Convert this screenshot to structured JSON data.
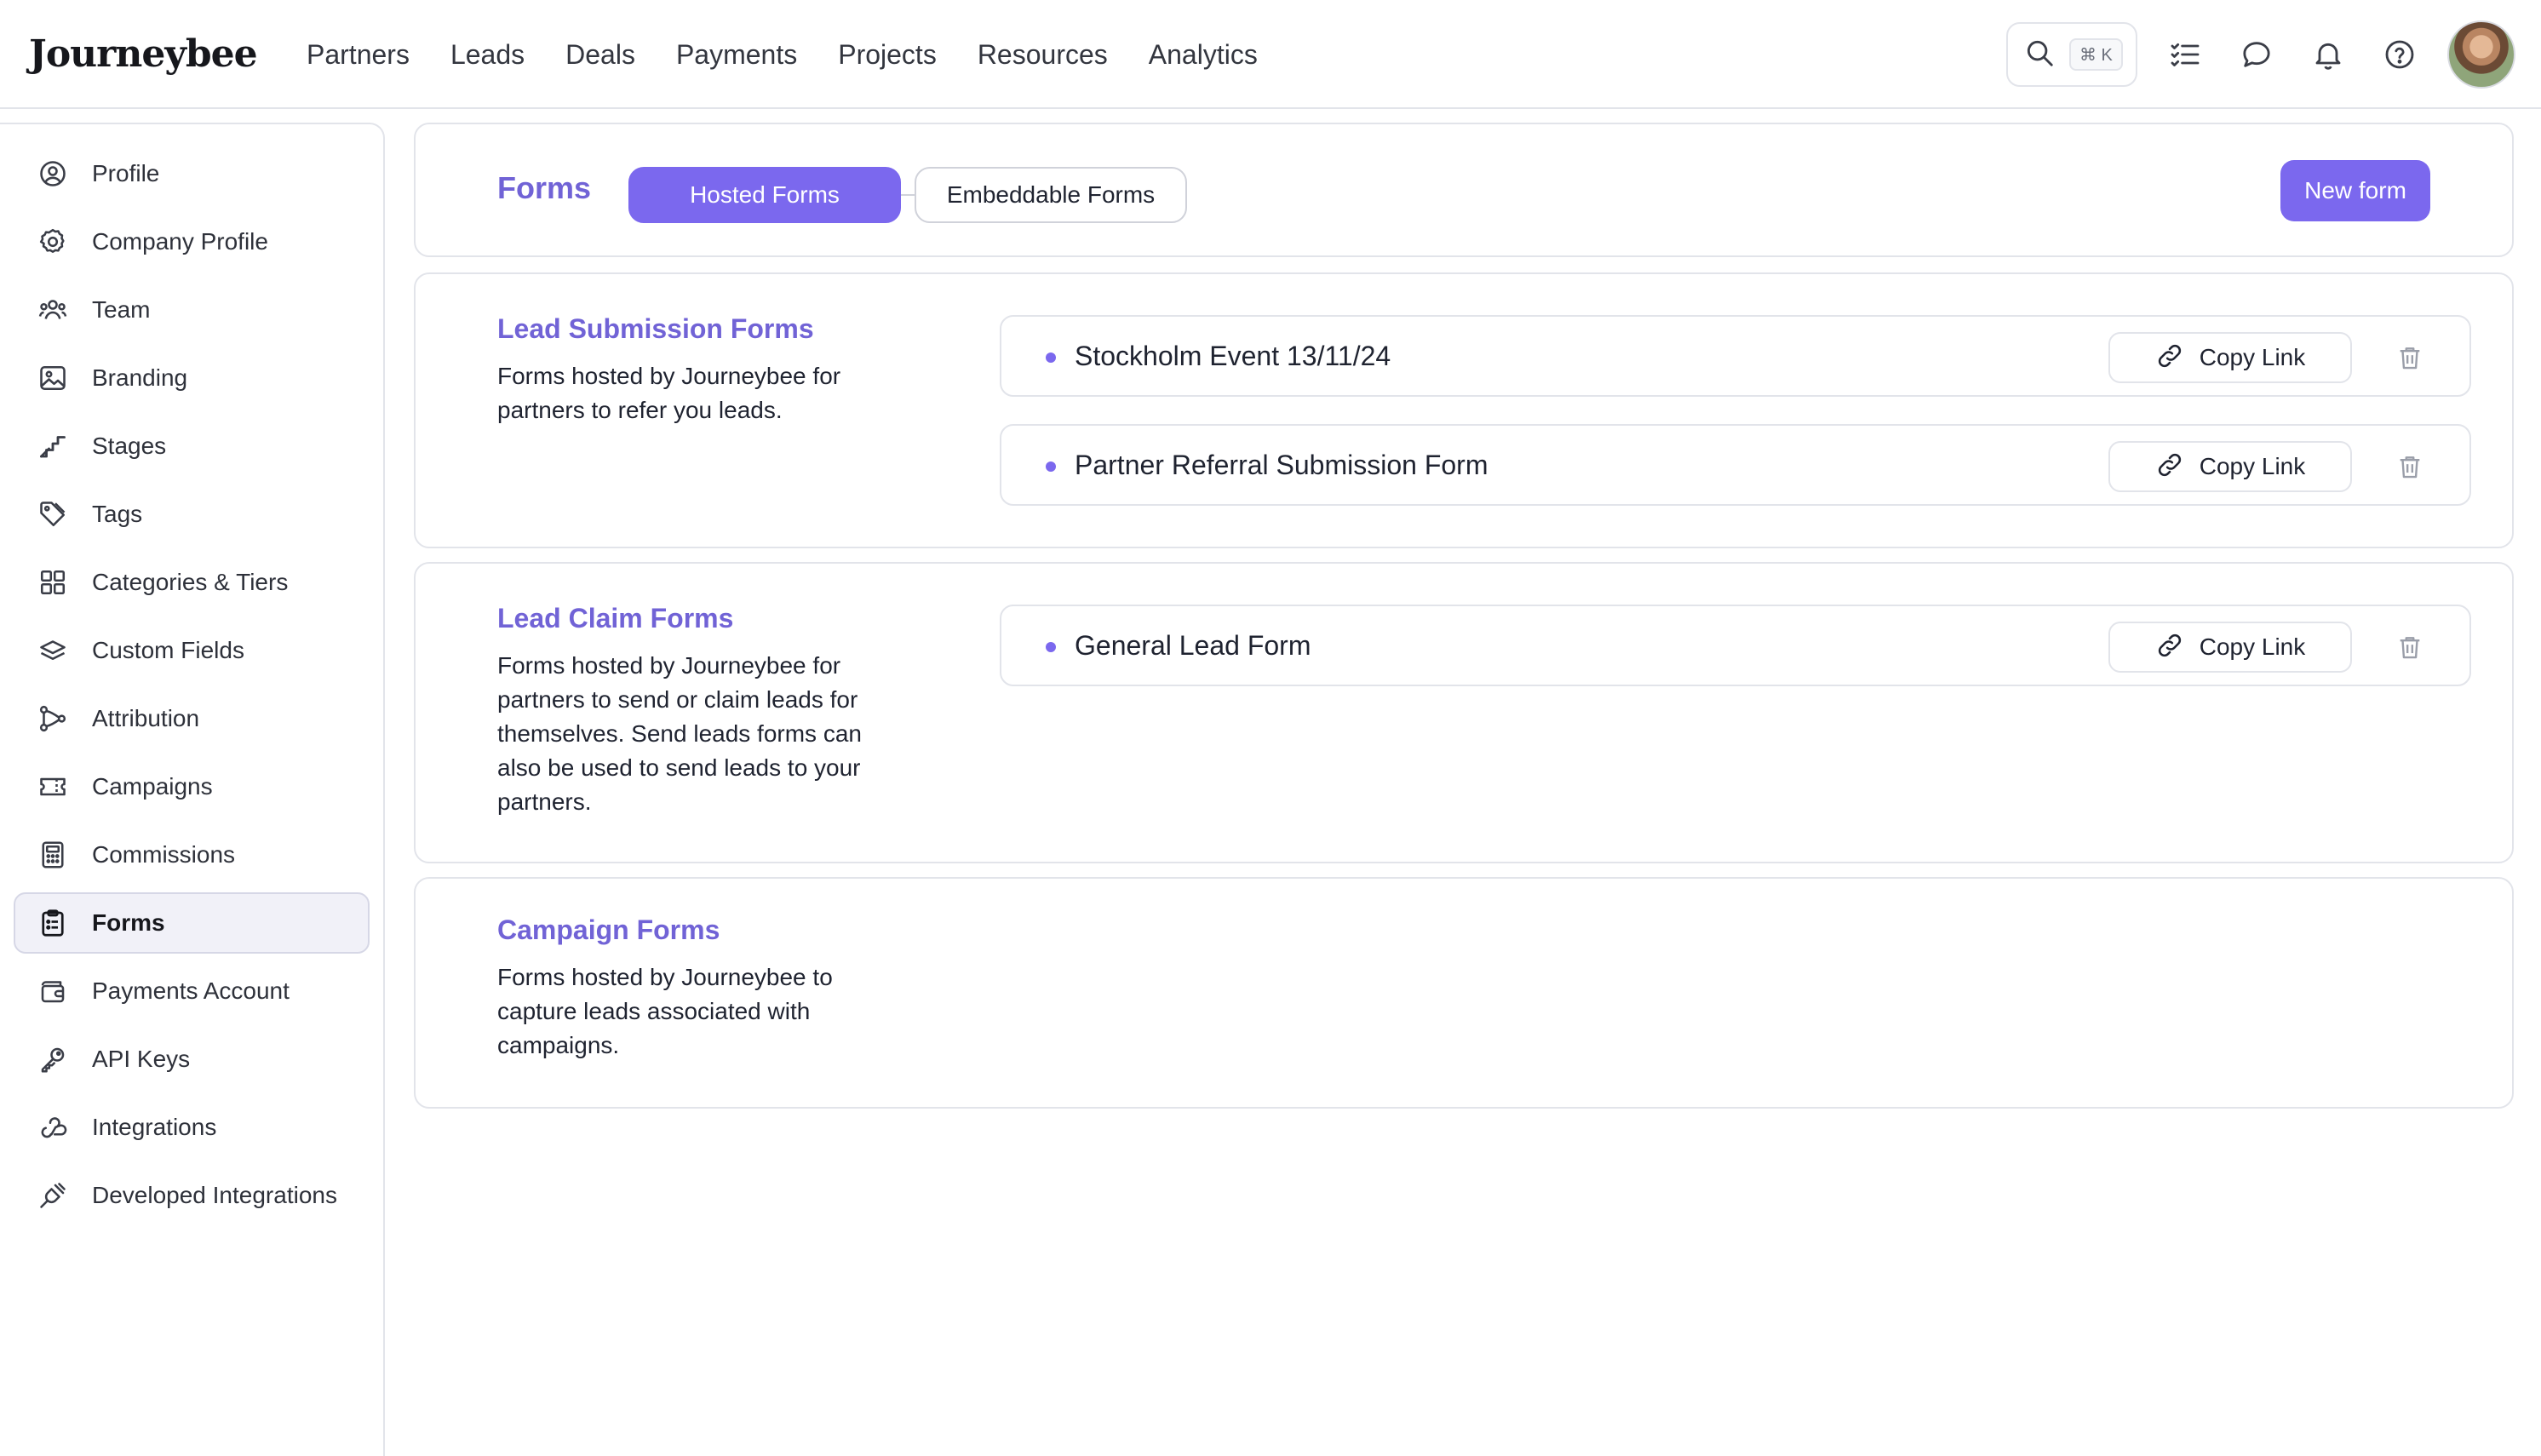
{
  "app": {
    "logo_text": "Journeybee"
  },
  "nav": {
    "items": [
      "Partners",
      "Leads",
      "Deals",
      "Payments",
      "Projects",
      "Resources",
      "Analytics"
    ]
  },
  "search": {
    "shortcut": "⌘ K"
  },
  "top_icons": [
    "search-icon",
    "checklist-icon",
    "chat-icon",
    "bell-icon",
    "help-icon"
  ],
  "sidebar": {
    "items": [
      {
        "label": "Profile",
        "icon": "user-circle-icon"
      },
      {
        "label": "Company Profile",
        "icon": "gear-icon"
      },
      {
        "label": "Team",
        "icon": "team-icon"
      },
      {
        "label": "Branding",
        "icon": "image-icon"
      },
      {
        "label": "Stages",
        "icon": "stairs-icon"
      },
      {
        "label": "Tags",
        "icon": "tag-icon"
      },
      {
        "label": "Categories & Tiers",
        "icon": "grid-icon"
      },
      {
        "label": "Custom Fields",
        "icon": "layers-icon"
      },
      {
        "label": "Attribution",
        "icon": "nodes-icon"
      },
      {
        "label": "Campaigns",
        "icon": "ticket-icon"
      },
      {
        "label": "Commissions",
        "icon": "calculator-icon"
      },
      {
        "label": "Forms",
        "icon": "clipboard-icon",
        "active": true
      },
      {
        "label": "Payments Account",
        "icon": "wallet-icon"
      },
      {
        "label": "API Keys",
        "icon": "key-icon"
      },
      {
        "label": "Integrations",
        "icon": "webhook-icon"
      },
      {
        "label": "Developed Integrations",
        "icon": "plug-icon"
      }
    ]
  },
  "header": {
    "title": "Forms",
    "tab_hosted": "Hosted Forms",
    "tab_embeddable": "Embeddable Forms",
    "active_tab": "Hosted Forms",
    "new_button": "New form"
  },
  "sections": [
    {
      "title": "Lead Submission Forms",
      "description": "Forms hosted by Journeybee for partners to refer you leads.",
      "forms": [
        "Stockholm Event 13/11/24",
        "Partner Referral Submission Form"
      ]
    },
    {
      "title": "Lead Claim Forms",
      "description": "Forms hosted by Journeybee for partners to send or claim leads for themselves. Send leads forms can also be used to send leads to your partners.",
      "forms": [
        "General Lead Form"
      ]
    },
    {
      "title": "Campaign Forms",
      "description": "Forms hosted by Journeybee to capture leads associated with campaigns.",
      "forms": []
    }
  ],
  "copy_link_label": "Copy Link",
  "colors": {
    "accent": "#7b68ee",
    "accent_text": "#7163d6",
    "border": "#e2e4ea"
  }
}
